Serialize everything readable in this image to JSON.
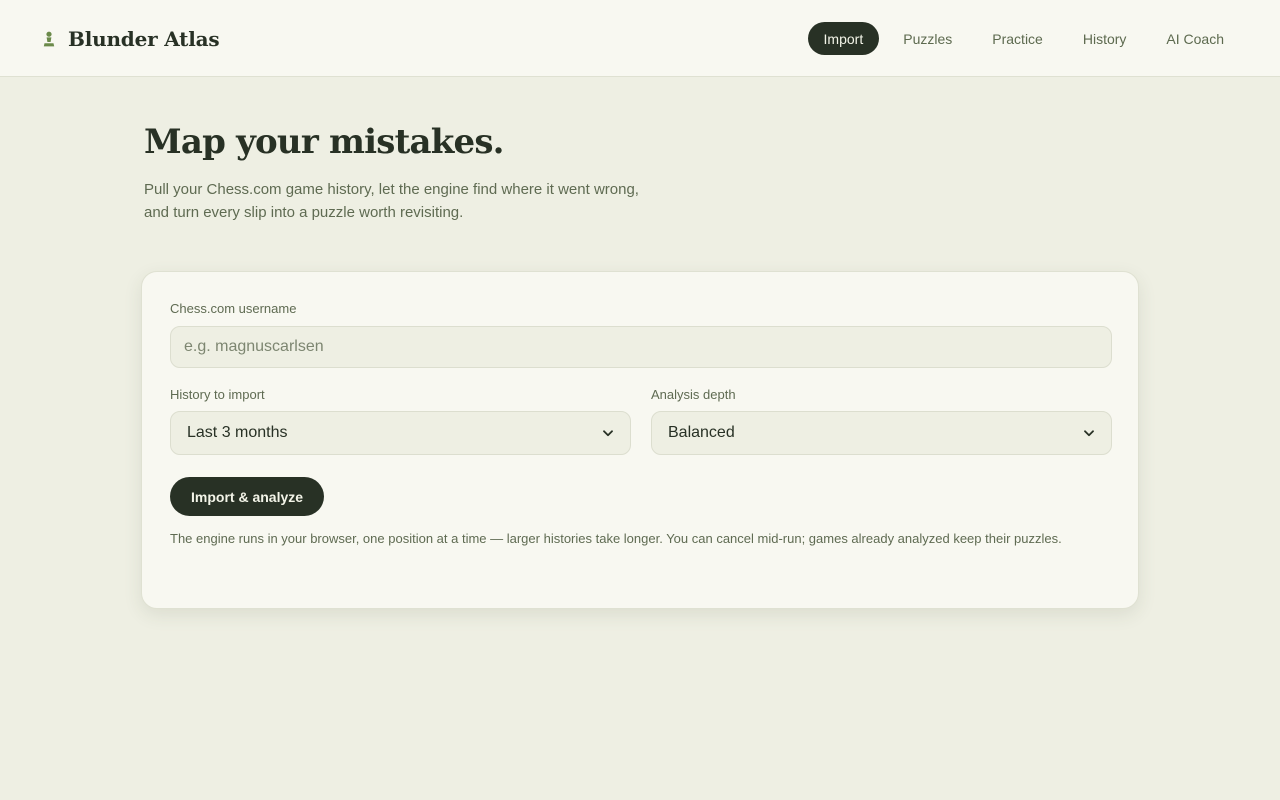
{
  "app": {
    "name": "Blunder Atlas",
    "logo_icon": "pawn-icon"
  },
  "nav": {
    "items": [
      {
        "label": "Import",
        "active": true
      },
      {
        "label": "Puzzles",
        "active": false
      },
      {
        "label": "Practice",
        "active": false
      },
      {
        "label": "History",
        "active": false
      },
      {
        "label": "AI Coach",
        "active": false
      }
    ]
  },
  "hero": {
    "title": "Map your mistakes.",
    "subtitle_line1": "Pull your Chess.com game history, let the engine find where it went wrong,",
    "subtitle_line2": "and turn every slip into a puzzle worth revisiting."
  },
  "form": {
    "username": {
      "label": "Chess.com username",
      "value": "",
      "placeholder": "e.g. magnuscarlsen"
    },
    "history": {
      "label": "History to import",
      "selected": "Last 3 months"
    },
    "depth": {
      "label": "Analysis depth",
      "selected": "Balanced"
    },
    "submit_label": "Import & analyze",
    "note": "The engine runs in your browser, one position at a time — larger histories take longer. You can cancel mid-run; games already analyzed keep their puzzles."
  },
  "colors": {
    "background": "#eeefe3",
    "surface": "#f8f8f1",
    "ink": "#283125",
    "muted": "#5f6b52",
    "accent": "#6b8a4a"
  }
}
